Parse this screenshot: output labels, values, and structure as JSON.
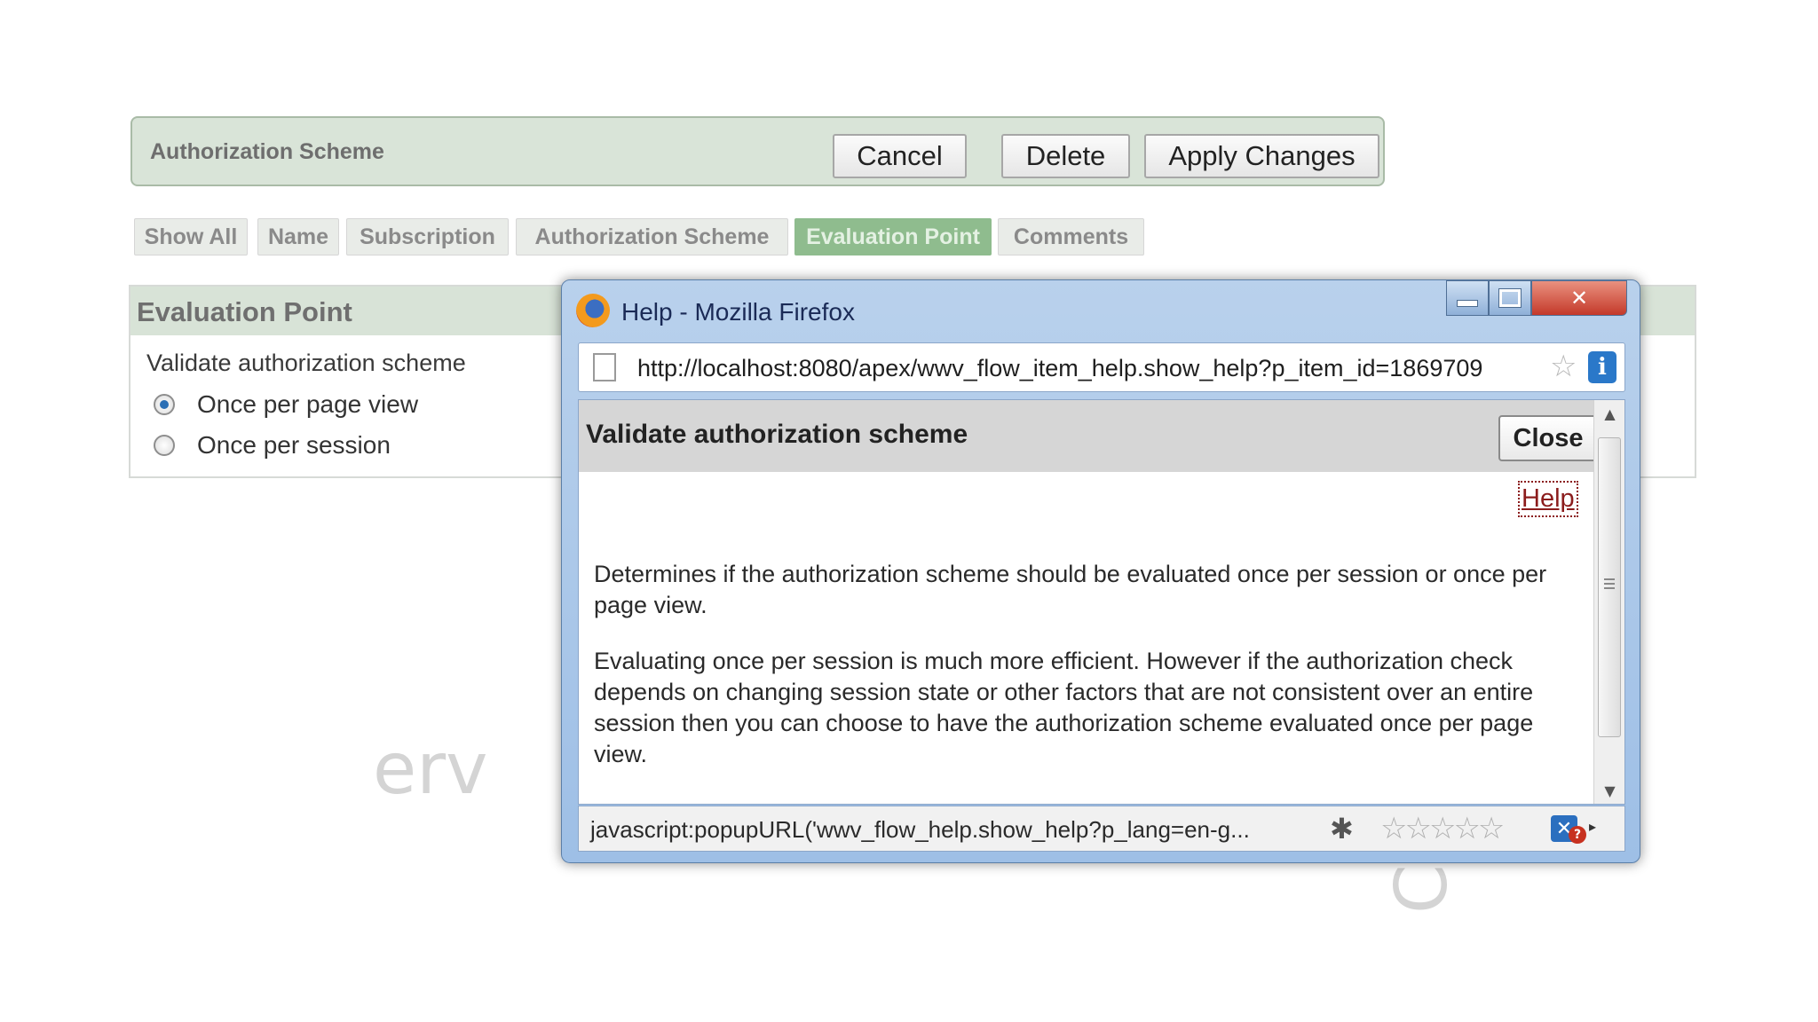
{
  "header": {
    "title": "Authorization Scheme",
    "cancel_label": "Cancel",
    "delete_label": "Delete",
    "apply_label": "Apply Changes"
  },
  "tabs": [
    {
      "label": "Show All",
      "active": false
    },
    {
      "label": "Name",
      "active": false
    },
    {
      "label": "Subscription",
      "active": false
    },
    {
      "label": "Authorization Scheme",
      "active": false
    },
    {
      "label": "Evaluation Point",
      "active": true
    },
    {
      "label": "Comments",
      "active": false
    }
  ],
  "region": {
    "title": "Evaluation Point",
    "field_label": "Validate authorization scheme",
    "options": [
      {
        "label": "Once per page view",
        "checked": true
      },
      {
        "label": "Once per session",
        "checked": false
      }
    ]
  },
  "popup": {
    "window_title": "Help - Mozilla Firefox",
    "url": "http://localhost:8080/apex/wwv_flow_item_help.show_help?p_item_id=1869709",
    "help_title": "Validate authorization scheme",
    "close_label": "Close",
    "help_link": "Help",
    "paragraphs": [
      "Determines if the authorization scheme should be evaluated once per session or once per page view.",
      "Evaluating once per session is much more efficient. However if the authorization check depends on changing session state or other factors that are not consistent over an entire session then you can choose to have the authorization scheme evaluated once per page view."
    ],
    "status_text": "javascript:popupURL('wwv_flow_help.show_help?p_lang=en-g..."
  },
  "watermark": {
    "text1": "erv",
    "text2": "Con"
  },
  "colors": {
    "active_tab": "#8fbc8e",
    "header_bg": "#d9e4d8",
    "window_frame": "#b9d1ec",
    "close_button": "#c4392a"
  },
  "icons": {
    "firefox": "firefox-logo-icon",
    "page": "page-icon",
    "bookmark": "star-icon",
    "info": "info-icon",
    "bug": "bug-icon",
    "rating": "rating-stars-icon"
  }
}
